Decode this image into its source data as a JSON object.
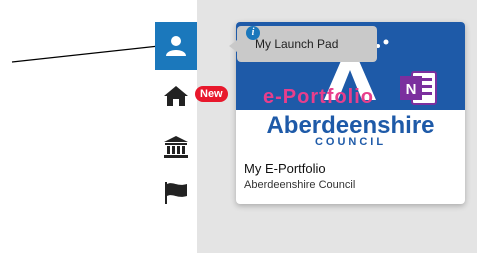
{
  "annotation": {
    "arrow_color": "#000000"
  },
  "sidebar": {
    "items": [
      {
        "icon": "user-icon",
        "active": true
      },
      {
        "icon": "home-icon",
        "badge": "New"
      },
      {
        "icon": "bank-icon"
      },
      {
        "icon": "flag-icon"
      }
    ]
  },
  "tooltip": {
    "label": "My Launch Pad"
  },
  "card": {
    "logo_text": "e-Portfolio",
    "brand": "Aberdeenshire",
    "brand_sub": "COUNCIL",
    "title": "My E-Portfolio",
    "subtitle": "Aberdeenshire Council",
    "app_icon": "onenote-icon"
  },
  "colors": {
    "accent": "#1b78bc",
    "badge": "#e8182c",
    "brand": "#1e5aa8",
    "onenote": "#7b2f9e"
  }
}
